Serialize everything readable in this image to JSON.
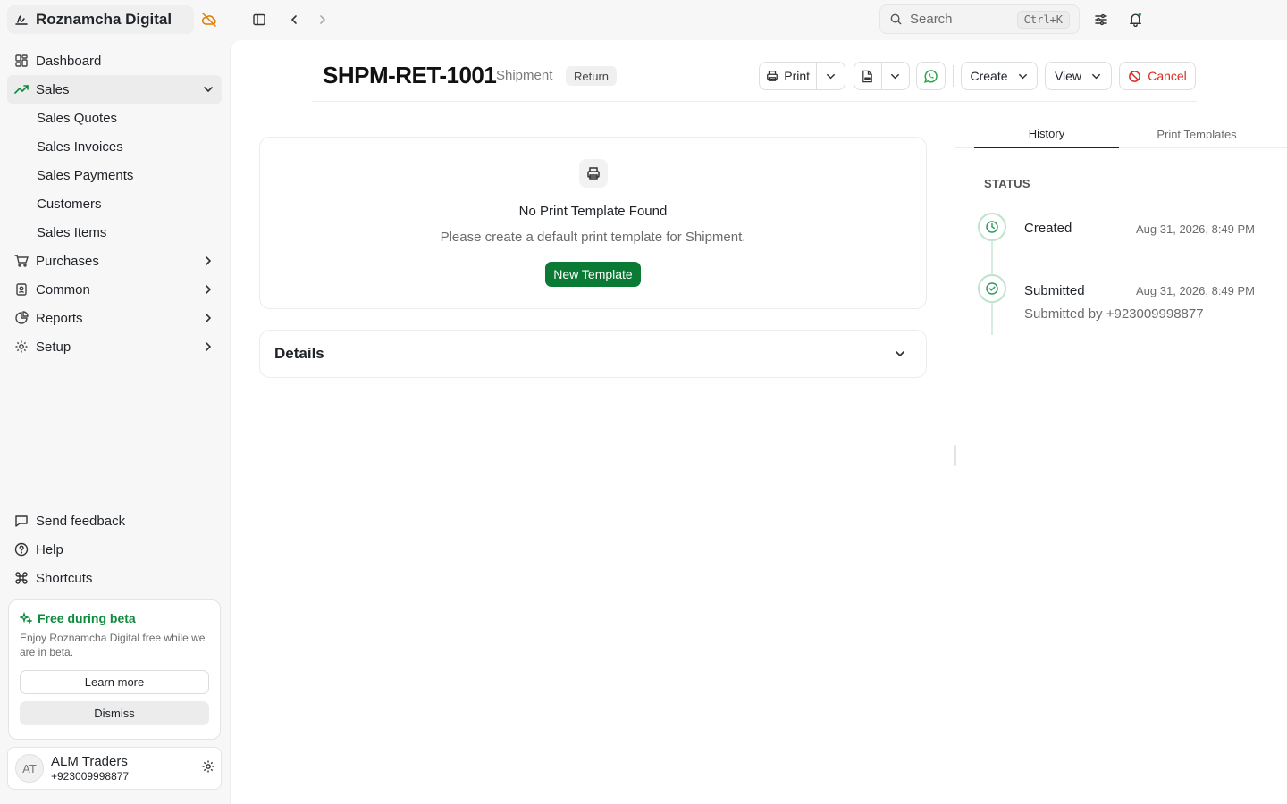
{
  "app": {
    "title": "Roznamcha Digital"
  },
  "sidebar": {
    "items": [
      {
        "label": "Dashboard",
        "icon": "dashboard-icon"
      },
      {
        "label": "Sales",
        "icon": "trending-up-icon",
        "expanded": true
      },
      {
        "label": "Purchases",
        "icon": "cart-icon"
      },
      {
        "label": "Common",
        "icon": "book-user-icon"
      },
      {
        "label": "Reports",
        "icon": "pie-chart-icon"
      },
      {
        "label": "Setup",
        "icon": "gear-icon"
      }
    ],
    "sales_sub": [
      "Sales Quotes",
      "Sales Invoices",
      "Sales Payments",
      "Customers",
      "Sales Items"
    ],
    "bottom": [
      {
        "label": "Send feedback",
        "icon": "message-icon"
      },
      {
        "label": "Help",
        "icon": "help-circle-icon"
      },
      {
        "label": "Shortcuts",
        "icon": "command-icon"
      }
    ]
  },
  "beta": {
    "title": "Free during beta",
    "desc": "Enjoy Roznamcha Digital free while we are in beta.",
    "learn_more": "Learn more",
    "dismiss": "Dismiss"
  },
  "user": {
    "initials": "AT",
    "name": "ALM Traders",
    "phone": "+923009998877"
  },
  "search": {
    "placeholder": "Search",
    "shortcut": "Ctrl+K"
  },
  "doc": {
    "title": "SHPM-RET-1001",
    "type": "Shipment",
    "badge": "Return"
  },
  "actions": {
    "print": "Print",
    "create": "Create",
    "view": "View",
    "cancel": "Cancel"
  },
  "print_card": {
    "title": "No Print Template Found",
    "desc": "Please create a default print template for Shipment.",
    "button": "New Template"
  },
  "details": {
    "title": "Details"
  },
  "tabs": {
    "history": "History",
    "templates": "Print Templates"
  },
  "status": {
    "label": "STATUS",
    "events": [
      {
        "title": "Created",
        "date": "Aug 31, 2026, 8:49 PM"
      },
      {
        "title": "Submitted",
        "date": "Aug 31, 2026, 8:49 PM",
        "sub": "Submitted by +923009998877"
      }
    ]
  },
  "colors": {
    "accent": "#0b7a35",
    "danger": "#d92d20",
    "warning": "#e07b00",
    "timeline": "#2f9e63"
  }
}
